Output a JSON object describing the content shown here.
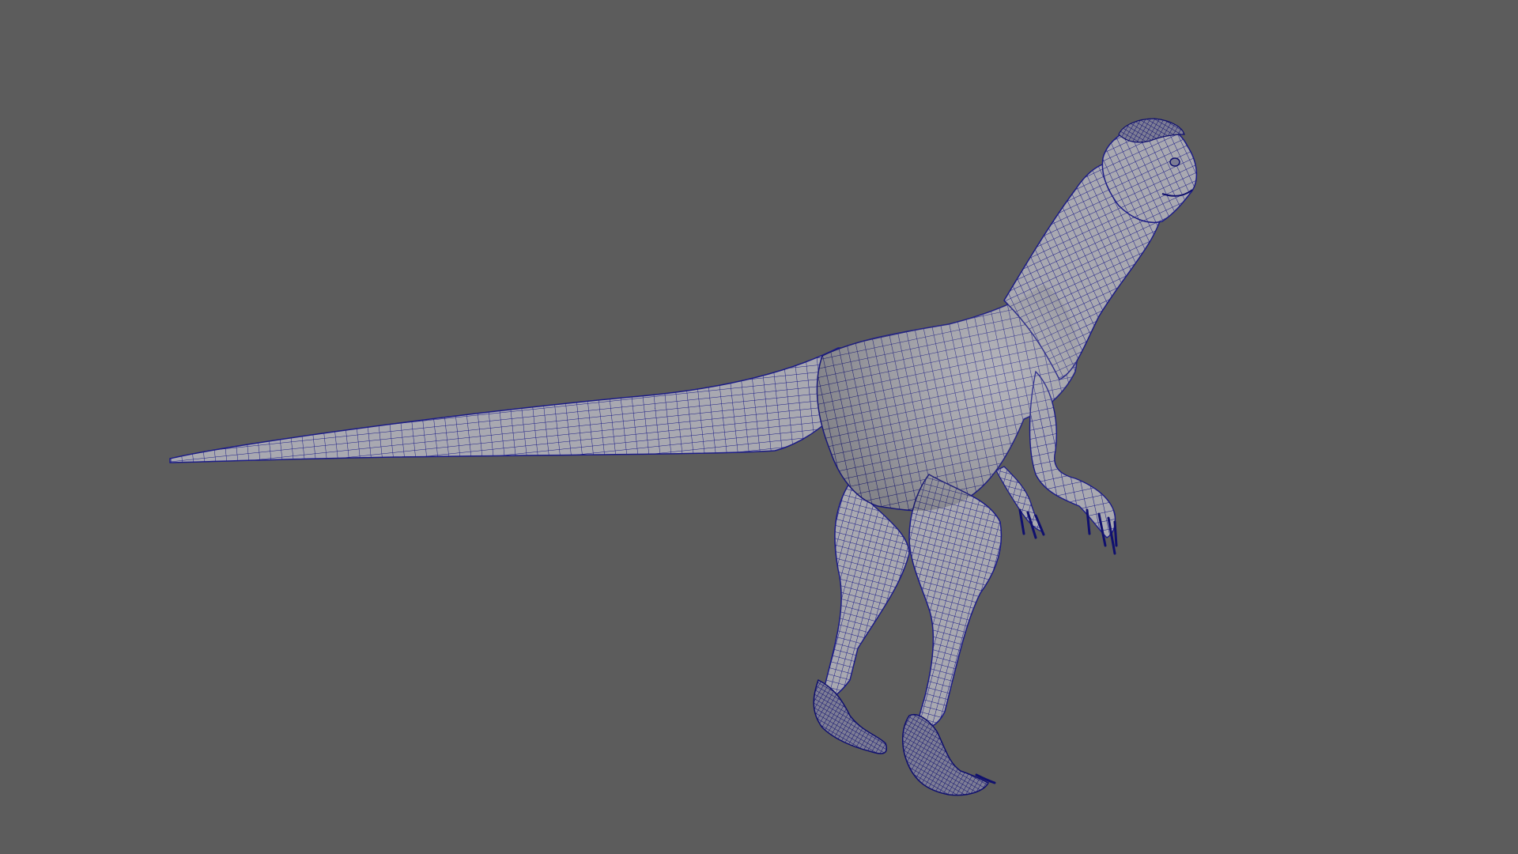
{
  "viewport": {
    "background": "#5c5c5c",
    "model": {
      "subject": "dinosaur-wireframe",
      "fill_color": "#a9a9b1",
      "wire_color": "#1c1c86",
      "wire_dense_color": "#10106e"
    }
  }
}
